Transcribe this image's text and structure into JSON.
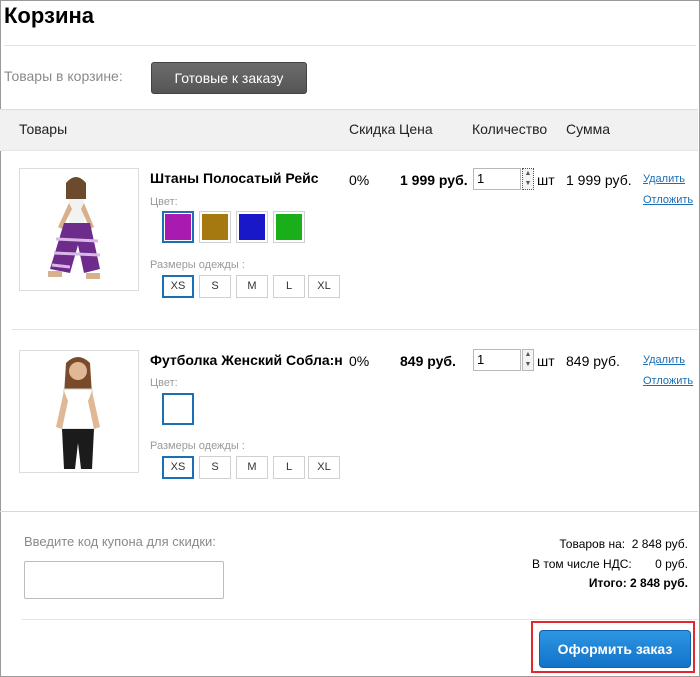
{
  "page": {
    "title": "Корзина"
  },
  "filter": {
    "label": "Товары в корзине:",
    "tab_label": "Готовые к заказу"
  },
  "table": {
    "headers": {
      "products": "Товары",
      "discount": "Скидка",
      "price": "Цена",
      "quantity": "Количество",
      "sum": "Сумма"
    }
  },
  "items": [
    {
      "name": "Штаны Полосатый Рейс",
      "color_label": "Цвет:",
      "colors": [
        "#a81ab0",
        "#a67810",
        "#1818c8",
        "#1aae1a"
      ],
      "selected_color_index": 0,
      "sizes_label": "Размеры одежды :",
      "sizes": [
        "XS",
        "S",
        "M",
        "L",
        "XL"
      ],
      "selected_size": "XS",
      "discount": "0%",
      "price": "1 999 руб.",
      "quantity": "1",
      "unit": "шт",
      "sum": "1 999 руб.",
      "delete_label": "Удалить",
      "postpone_label": "Отложить"
    },
    {
      "name": "Футболка Женский Собла:н",
      "color_label": "Цвет:",
      "colors": [
        "#ffffff"
      ],
      "selected_color_index": 0,
      "sizes_label": "Размеры одежды :",
      "sizes": [
        "XS",
        "S",
        "M",
        "L",
        "XL"
      ],
      "selected_size": "XS",
      "discount": "0%",
      "price": "849 руб.",
      "quantity": "1",
      "unit": "шт",
      "sum": "849 руб.",
      "delete_label": "Удалить",
      "postpone_label": "Отложить"
    }
  ],
  "coupon": {
    "label": "Введите код купона для скидки:",
    "value": ""
  },
  "summary": {
    "goods_label": "Товаров на:",
    "goods_value": "2 848 руб.",
    "vat_label": "В том числе НДС:",
    "vat_value": "0 руб.",
    "total_label": "Итого:",
    "total_value": "2 848 руб."
  },
  "order_button": {
    "label": "Оформить заказ"
  }
}
